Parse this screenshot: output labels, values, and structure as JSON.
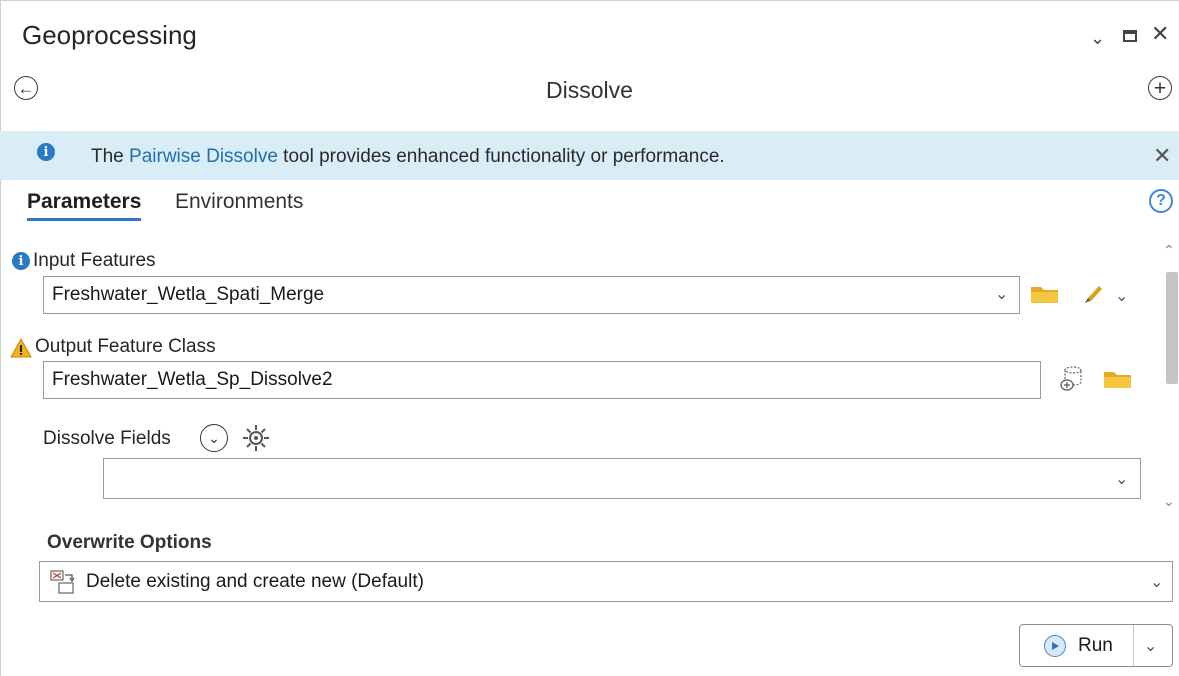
{
  "pane": {
    "title": "Geoprocessing",
    "tool_title": "Dissolve"
  },
  "info_banner": {
    "prefix": "The ",
    "link": "Pairwise Dissolve",
    "suffix": " tool provides enhanced functionality or performance."
  },
  "tabs": {
    "parameters": "Parameters",
    "environments": "Environments"
  },
  "params": {
    "input_features": {
      "label": "Input Features",
      "value": "Freshwater_Wetla_Spati_Merge"
    },
    "output_feature_class": {
      "label": "Output Feature Class",
      "value": "Freshwater_Wetla_Sp_Dissolve2"
    },
    "dissolve_fields": {
      "label": "Dissolve Fields",
      "value": ""
    }
  },
  "overwrite": {
    "label": "Overwrite Options",
    "value": "Delete existing and create new (Default)"
  },
  "run": {
    "label": "Run"
  },
  "icons": {
    "info": "info-icon",
    "warning": "warning-icon",
    "folder": "folder-icon",
    "pencil": "pencil-icon",
    "gear": "gear-icon"
  },
  "colors": {
    "info_banner_bg": "#d9edf7",
    "accent_blue": "#2e76c4",
    "link_blue": "#1f6fb2",
    "warning_yellow": "#f2b01e",
    "folder_yellow": "#f3c13a"
  }
}
